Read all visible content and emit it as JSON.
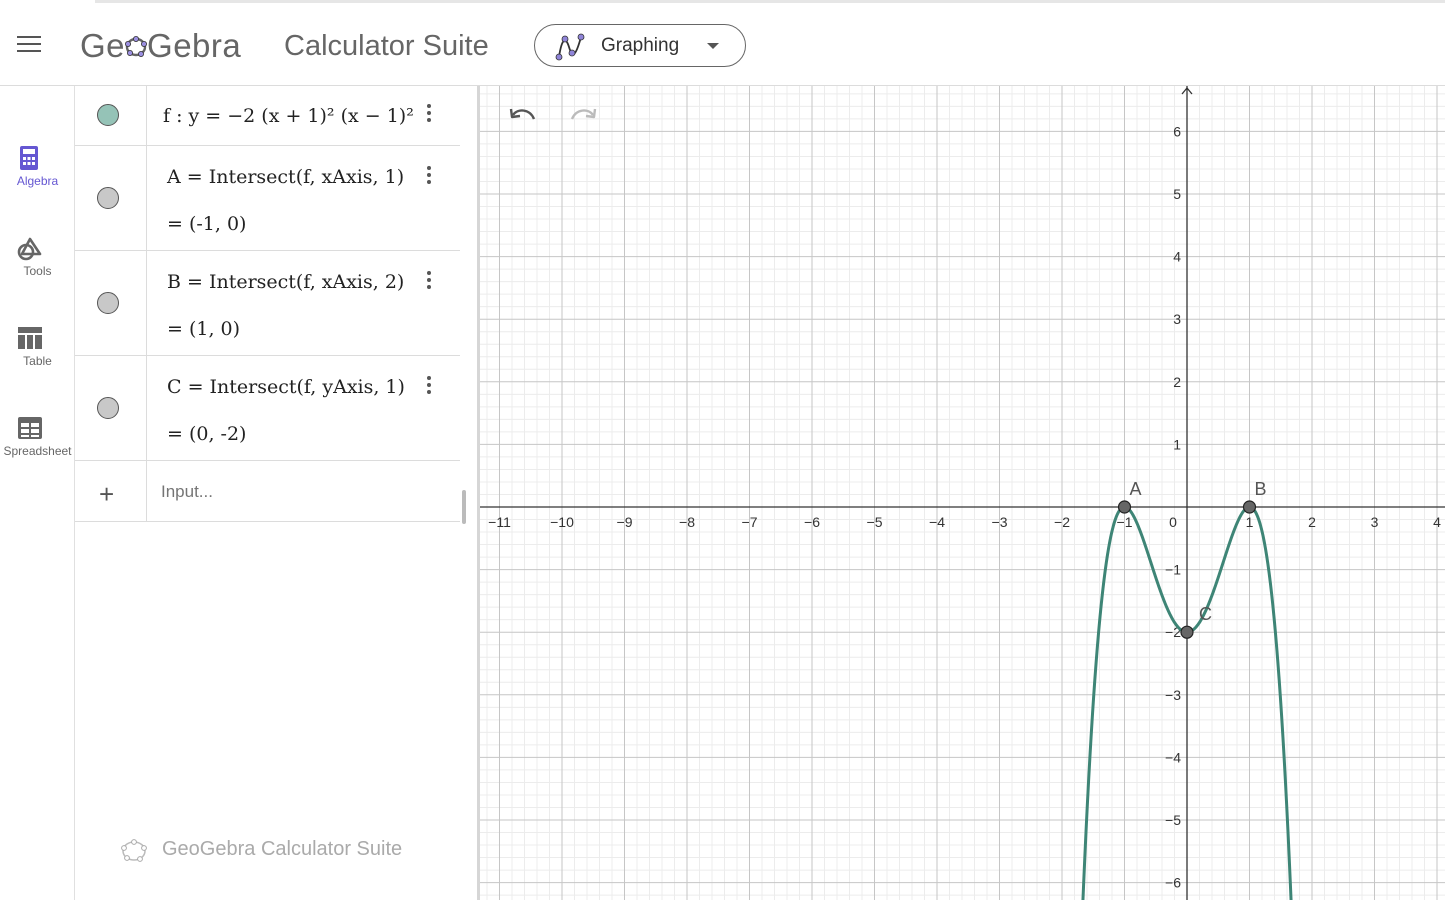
{
  "header": {
    "logo_text_1": "Ge",
    "logo_text_2": "Gebra",
    "suite_title": "Calculator Suite",
    "app_switcher_label": "Graphing"
  },
  "sidebar": {
    "items": [
      {
        "label": "Algebra",
        "icon": "calculator-icon",
        "active": true
      },
      {
        "label": "Tools",
        "icon": "tools-icon",
        "active": false
      },
      {
        "label": "Table",
        "icon": "table-icon",
        "active": false
      },
      {
        "label": "Spreadsheet",
        "icon": "spreadsheet-icon",
        "active": false
      }
    ]
  },
  "algebra": {
    "rows": [
      {
        "name": "f",
        "definition": "f : y = −2 (x + 1)² (x − 1)²",
        "visible": true,
        "color": "#95c3b7"
      },
      {
        "name": "A",
        "definition": "A = Intersect(f, xAxis, 1)",
        "value": "= (-1, 0)",
        "visible": false,
        "color": "#c8c8c8"
      },
      {
        "name": "B",
        "definition": "B = Intersect(f, xAxis, 2)",
        "value": "= (1, 0)",
        "visible": false,
        "color": "#c8c8c8"
      },
      {
        "name": "C",
        "definition": "C = Intersect(f, yAxis, 1)",
        "value": "= (0, -2)",
        "visible": false,
        "color": "#c8c8c8"
      }
    ],
    "input_placeholder": "Input...",
    "watermark": "GeoGebra Calculator Suite"
  },
  "chart_data": {
    "type": "line",
    "function": "y = -2 (x + 1)^2 (x - 1)^2",
    "xlim": [
      -11.3,
      4.1
    ],
    "ylim": [
      -6.2,
      6.8
    ],
    "x_ticks": [
      -11,
      -10,
      -9,
      -8,
      -7,
      -6,
      -5,
      -4,
      -3,
      -2,
      -1,
      0,
      1,
      2,
      3,
      4
    ],
    "y_ticks": [
      -6,
      -5,
      -4,
      -3,
      -2,
      -1,
      1,
      2,
      3,
      4,
      5,
      6
    ],
    "grid": true,
    "curve_color": "#3e8576",
    "points": [
      {
        "label": "A",
        "x": -1,
        "y": 0
      },
      {
        "label": "B",
        "x": 1,
        "y": 0
      },
      {
        "label": "C",
        "x": 0,
        "y": -2
      }
    ]
  },
  "colors": {
    "accent": "#6557d2",
    "curve": "#3e8576",
    "axis": "#333333"
  }
}
